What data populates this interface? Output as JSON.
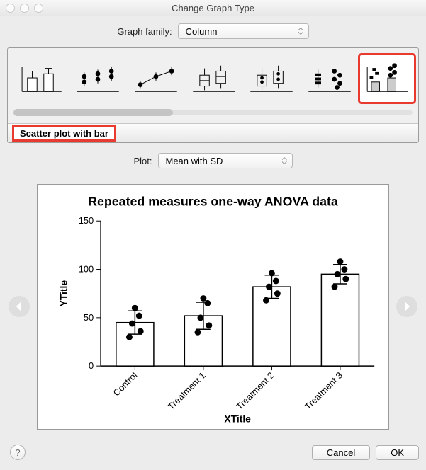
{
  "window": {
    "title": "Change Graph Type"
  },
  "graphFamily": {
    "label": "Graph family:",
    "value": "Column"
  },
  "thumbs": [
    {
      "name": "bar"
    },
    {
      "name": "scatter"
    },
    {
      "name": "line-scatter"
    },
    {
      "name": "box"
    },
    {
      "name": "box-overlay"
    },
    {
      "name": "aligned-scatter"
    },
    {
      "name": "scatter-bar"
    }
  ],
  "selectedThumbIndex": 6,
  "graphTypeName": "Scatter plot with bar",
  "plot": {
    "label": "Plot:",
    "value": "Mean with SD"
  },
  "footer": {
    "cancel": "Cancel",
    "ok": "OK",
    "help": "?"
  },
  "chart_data": {
    "type": "bar",
    "title": "Repeated measures one-way ANOVA data",
    "xlabel": "XTitle",
    "ylabel": "YTitle",
    "categories": [
      "Control",
      "Treatment 1",
      "Treatment 2",
      "Treatment 3"
    ],
    "series": [
      {
        "name": "Mean",
        "values": [
          45,
          52,
          82,
          95
        ]
      },
      {
        "name": "SD",
        "values": [
          12,
          14,
          12,
          10
        ]
      }
    ],
    "scatter": [
      [
        30,
        36,
        44,
        52,
        60
      ],
      [
        35,
        42,
        50,
        65,
        70
      ],
      [
        68,
        75,
        82,
        88,
        96
      ],
      [
        82,
        90,
        95,
        100,
        108
      ]
    ],
    "ylim": [
      0,
      150
    ],
    "yticks": [
      0,
      50,
      100,
      150
    ]
  }
}
